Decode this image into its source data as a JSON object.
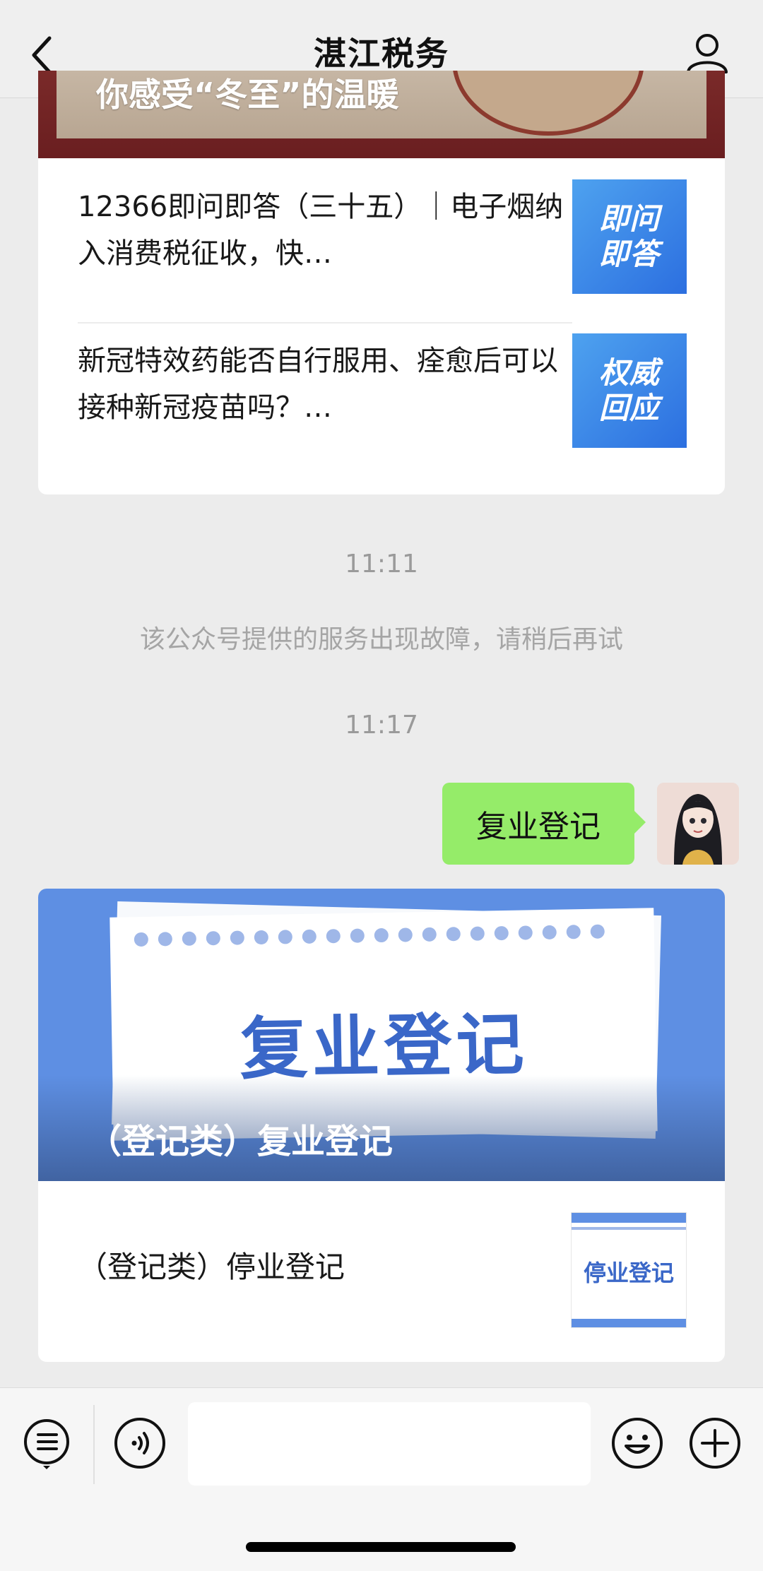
{
  "nav": {
    "title": "湛江税务",
    "back_icon": "chevron-left-icon",
    "profile_icon": "user-icon"
  },
  "article_card": {
    "banner_text": "你感受“冬至”的温暖",
    "items": [
      {
        "title": "12366即问即答（三十五）｜电子烟纳入消费税征收，快…",
        "thumb_text": "即问即答"
      },
      {
        "title": "新冠特效药能否自行服用、痊愈后可以接种新冠疫苗吗？…",
        "thumb_text": "权威回应"
      }
    ]
  },
  "messages": {
    "time1": "11:11",
    "system_notice": "该公众号提供的服务出现故障，请稍后再试",
    "time2": "11:17",
    "sent_text": "复业登记"
  },
  "reply_card": {
    "banner_big_text": "复业登记",
    "banner_caption": "（登记类）复业登记",
    "item_title": "（登记类）停业登记",
    "item_thumb_text": "停业登记"
  },
  "input_bar": {
    "menu_icon": "menu-list-icon",
    "voice_icon": "voice-icon",
    "emoji_icon": "emoji-icon",
    "plus_icon": "plus-icon",
    "text_value": ""
  },
  "colors": {
    "bubble_green": "#95ec69",
    "banner_blue": "#5e8fe3",
    "thumb_blue": "#2c6fe0"
  }
}
